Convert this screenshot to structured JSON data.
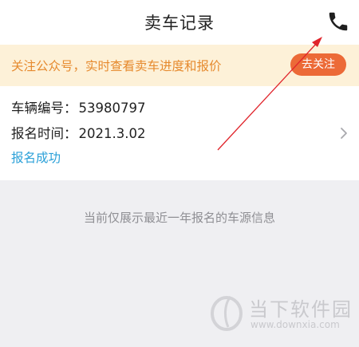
{
  "header": {
    "title": "卖车记录",
    "phone_icon": "phone-icon"
  },
  "banner": {
    "text": "关注公众号，实时查看卖车进度和报价",
    "button_label": "去关注"
  },
  "record": {
    "number_label": "车辆编号：",
    "number_value": "53980797",
    "time_label": "报名时间：",
    "time_value": "2021.3.02",
    "status": "报名成功",
    "chevron_icon": "chevron-right-icon"
  },
  "notice": "当前仅展示最近一年报名的车源信息",
  "watermark": {
    "name": "当下软件园",
    "url": "www.downxia.com"
  },
  "colors": {
    "accent_orange": "#ec6a37",
    "banner_text": "#e68a2e",
    "banner_bg": "#fdf1d8",
    "status_blue": "#2aa0d8",
    "annotation_red": "#e0242b",
    "page_bg": "#efeff2"
  }
}
